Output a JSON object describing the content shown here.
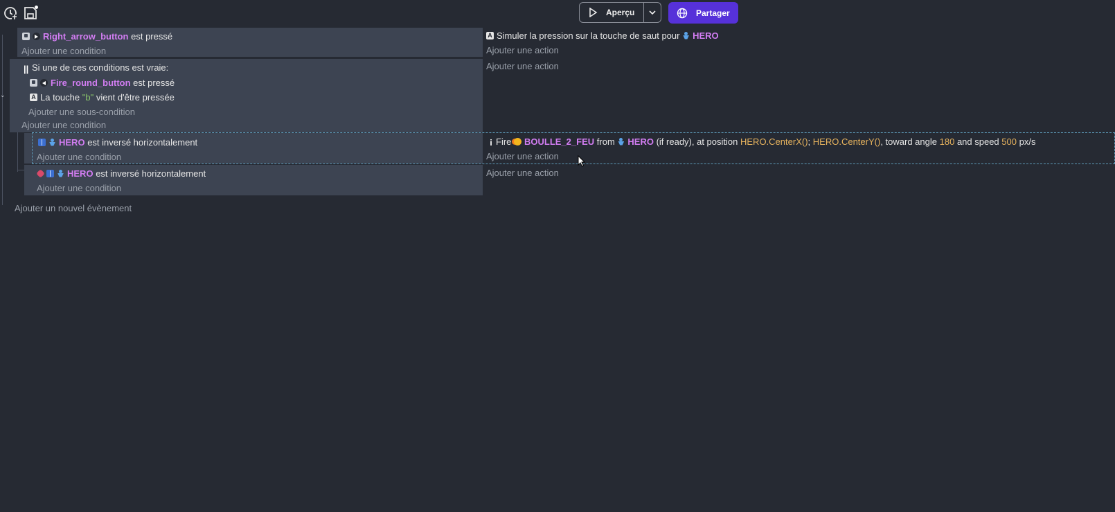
{
  "toolbar": {
    "history_icon": "history-icon",
    "save_icon": "save-icon",
    "preview_label": "Aperçu",
    "share_label": "Partager"
  },
  "events": {
    "e1": {
      "condition": {
        "object": "Right_arrow_button",
        "text": "est pressé"
      },
      "add_condition": "Ajouter une condition",
      "action": {
        "text": "Simuler la pression sur la touche de saut pour",
        "object": "HERO"
      },
      "add_action": "Ajouter une action"
    },
    "e2": {
      "or_label": "Si une de ces conditions est vraie:",
      "sub1": {
        "object": "Fire_round_button",
        "text": "est pressé"
      },
      "sub2": {
        "prefix": "La touche",
        "key": "\"b\"",
        "suffix": "vient d'être pressée"
      },
      "add_subcondition": "Ajouter une sous-condition",
      "add_condition": "Ajouter une condition",
      "add_action": "Ajouter une action"
    },
    "e3": {
      "condition": {
        "object": "HERO",
        "text": "est inversé horizontalement"
      },
      "add_condition": "Ajouter une condition",
      "action": {
        "fire": "Fire",
        "projectile": "BOULLE_2_FEU",
        "from": "from",
        "object": "HERO",
        "ready": "(if ready), at position",
        "x_expr": "HERO.CenterX()",
        "sep": ";",
        "y_expr": "HERO.CenterY()",
        "angle_text": ", toward angle",
        "angle": "180",
        "speed_text": "and speed",
        "speed": "500",
        "unit": "px/s"
      },
      "add_action": "Ajouter une action"
    },
    "e4": {
      "condition": {
        "object": "HERO",
        "text": "est inversé horizontalement"
      },
      "add_condition": "Ajouter une condition",
      "add_action": "Ajouter une action"
    },
    "add_event": "Ajouter un nouvel évènement"
  }
}
